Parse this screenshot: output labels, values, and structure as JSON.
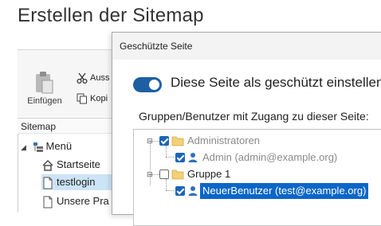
{
  "page": {
    "title": "Erstellen der Sitemap"
  },
  "ribbon": {
    "paste_label": "Einfügen",
    "cut_label": "Auss",
    "copy_label": "Kopi"
  },
  "sitemap": {
    "header": "Sitemap",
    "items": [
      {
        "label": "Menü"
      },
      {
        "label": "Startseite"
      },
      {
        "label": "testlogin"
      },
      {
        "label": "Unsere Pra"
      }
    ]
  },
  "dialog": {
    "title": "Geschützte Seite",
    "protect_toggle_label": "Diese Seite als geschützt einstellen",
    "protect_toggle_on": true,
    "access_label": "Gruppen/Benutzer mit Zugang zu dieser Seite:",
    "tree": [
      {
        "label": "Administratoren",
        "checked": true
      },
      {
        "label": "Admin (admin@example.org)",
        "checked": true
      },
      {
        "label": "Gruppe 1",
        "checked": false
      },
      {
        "label": "NeuerBenutzer (test@example.org)",
        "checked": true,
        "selected": true
      }
    ]
  },
  "colors": {
    "accent": "#1e5fa3",
    "selection": "#0a66c8",
    "folder": "#e8b54a"
  }
}
